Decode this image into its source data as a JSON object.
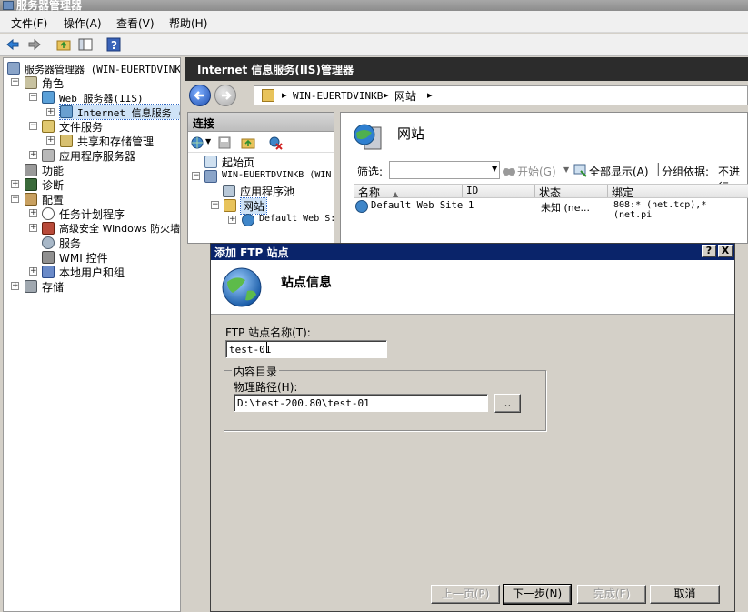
{
  "window": {
    "title": "服务器管理器"
  },
  "menu": [
    "文件(F)",
    "操作(A)",
    "查看(V)",
    "帮助(H)"
  ],
  "left_tree": [
    {
      "label": "服务器管理器 (WIN-EUERTDVINK",
      "icon": "server-manager-icon"
    },
    {
      "label": "角色",
      "icon": "roles-icon"
    },
    {
      "label": "Web 服务器(IIS)",
      "icon": "web-server-icon"
    },
    {
      "label": "Internet 信息服务 (",
      "icon": "iis-icon"
    },
    {
      "label": "文件服务",
      "icon": "file-service-icon"
    },
    {
      "label": "共享和存储管理",
      "icon": "share-storage-icon"
    },
    {
      "label": "应用程序服务器",
      "icon": "app-server-icon"
    },
    {
      "label": "功能",
      "icon": "features-icon"
    },
    {
      "label": "诊断",
      "icon": "diagnostics-icon"
    },
    {
      "label": "配置",
      "icon": "config-icon"
    },
    {
      "label": "任务计划程序",
      "icon": "task-scheduler-icon"
    },
    {
      "label": "高级安全 Windows 防火墙",
      "icon": "firewall-icon"
    },
    {
      "label": "服务",
      "icon": "services-icon"
    },
    {
      "label": "WMI 控件",
      "icon": "wmi-icon"
    },
    {
      "label": "本地用户和组",
      "icon": "users-groups-icon"
    },
    {
      "label": "存储",
      "icon": "storage-icon"
    }
  ],
  "iis": {
    "header": "Internet 信息服务(IIS)管理器",
    "breadcrumb": [
      "WIN-EUERTDVINKB",
      "网站"
    ],
    "connections": {
      "title": "连接",
      "tree": [
        "起始页",
        "WIN-EUERTDVINKB (WIN",
        "应用程序池",
        "网站",
        "Default Web S:"
      ]
    },
    "sites": {
      "title": "网站",
      "filter_label": "筛选:",
      "start_label": "开始(G)",
      "show_all_label": "全部显示(A)",
      "group_by_label": "分组依据:",
      "group_by_value": "不进行",
      "columns": [
        "名称",
        "ID",
        "状态",
        "绑定"
      ],
      "rows": [
        {
          "name": "Default Web Site",
          "id": "1",
          "status": "未知 (ne...",
          "binding": "808:* (net.tcp),* (net.pi"
        }
      ]
    }
  },
  "dialog": {
    "title": "添加 FTP 站点",
    "help_button": "?",
    "close_button": "X",
    "heading": "站点信息",
    "site_name_label": "FTP 站点名称(T):",
    "site_name_value": "test-01",
    "group_legend": "内容目录",
    "path_label": "物理路径(H):",
    "path_value": "D:\\test-200.80\\test-01",
    "browse_button": "..",
    "buttons": {
      "prev": "上一页(P)",
      "next": "下一步(N)",
      "finish": "完成(F)",
      "cancel": "取消"
    }
  },
  "colors": {
    "dialog_title_bg": "#0a246a",
    "iis_header_bg": "#2c2c2c",
    "window_bg": "#d4d0c8"
  }
}
